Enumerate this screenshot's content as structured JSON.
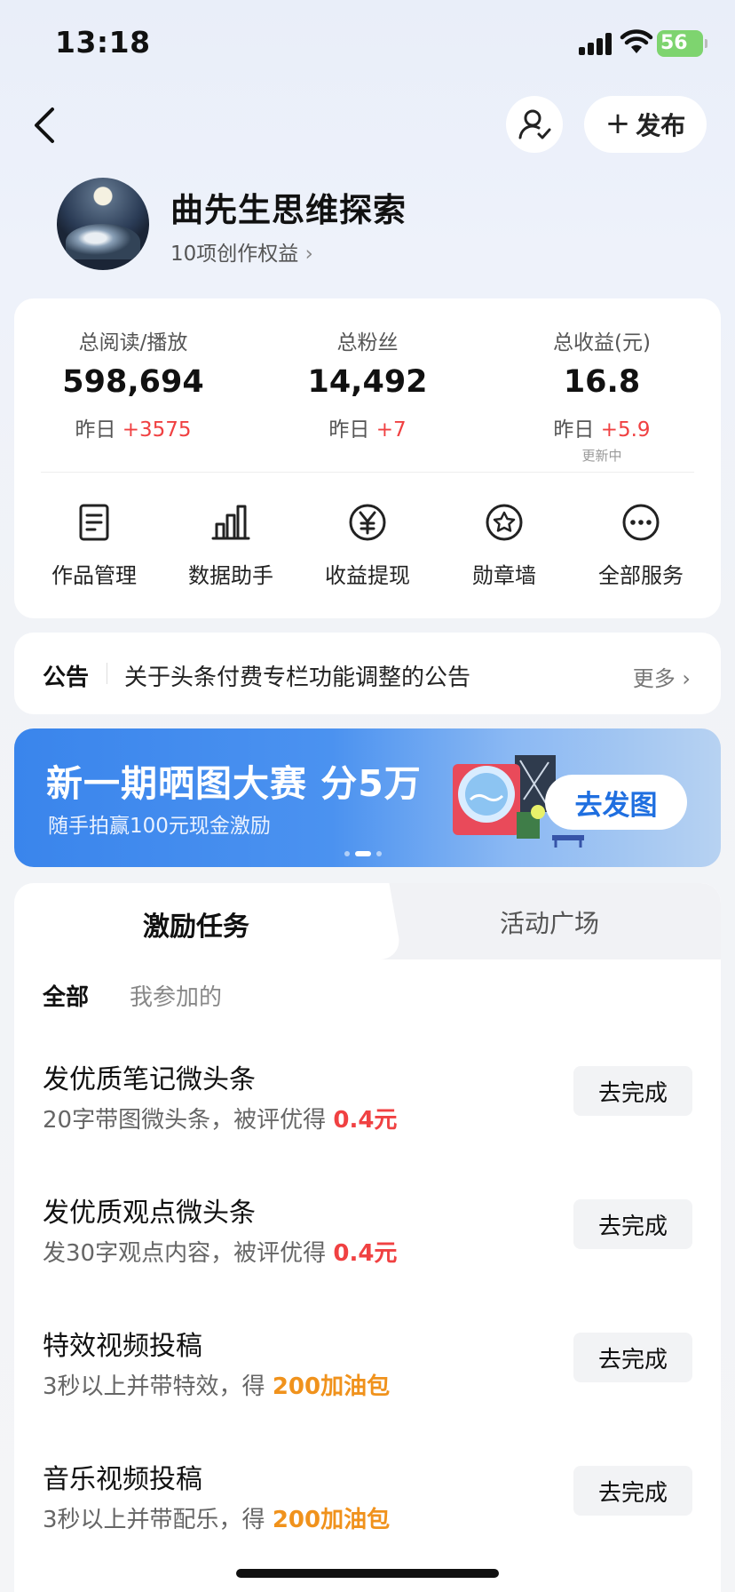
{
  "status_bar": {
    "time": "13:18",
    "battery": "56"
  },
  "header": {
    "publish_label": "发布"
  },
  "profile": {
    "name": "曲先生思维探索",
    "rights_link": "10项创作权益"
  },
  "stats": [
    {
      "label": "总阅读/播放",
      "value": "598,694",
      "delta_prefix": "昨日",
      "delta": "+3575",
      "note": ""
    },
    {
      "label": "总粉丝",
      "value": "14,492",
      "delta_prefix": "昨日",
      "delta": "+7",
      "note": ""
    },
    {
      "label": "总收益(元)",
      "value": "16.8",
      "delta_prefix": "昨日",
      "delta": "+5.9",
      "note": "更新中"
    }
  ],
  "services": [
    {
      "label": "作品管理",
      "icon": "document-icon"
    },
    {
      "label": "数据助手",
      "icon": "bar-chart-icon"
    },
    {
      "label": "收益提现",
      "icon": "yen-icon"
    },
    {
      "label": "勋章墙",
      "icon": "badge-icon"
    },
    {
      "label": "全部服务",
      "icon": "more-icon"
    }
  ],
  "notice": {
    "tag": "公告",
    "text": "关于头条付费专栏功能调整的公告",
    "more": "更多"
  },
  "banner": {
    "title": "新一期晒图大赛 分5万",
    "subtitle": "随手拍赢100元现金激励",
    "cta": "去发图",
    "page_index": 2,
    "page_count": 3
  },
  "tasks_panel": {
    "tabs": [
      "激励任务",
      "活动广场"
    ],
    "filters": [
      "全部",
      "我参加的"
    ],
    "items": [
      {
        "title": "发优质笔记微头条",
        "desc": "20字带图微头条，被评优得",
        "reward": "0.4元",
        "reward_color": "#f04142",
        "button": "去完成"
      },
      {
        "title": "发优质观点微头条",
        "desc": "发30字观点内容，被评优得",
        "reward": "0.4元",
        "reward_color": "#f04142",
        "button": "去完成"
      },
      {
        "title": "特效视频投稿",
        "desc": "3秒以上并带特效，得",
        "reward": "200加油包",
        "reward_color": "#f0921c",
        "button": "去完成"
      },
      {
        "title": "音乐视频投稿",
        "desc": "3秒以上并带配乐，得",
        "reward": "200加油包",
        "reward_color": "#f0921c",
        "button": "去完成"
      }
    ]
  }
}
